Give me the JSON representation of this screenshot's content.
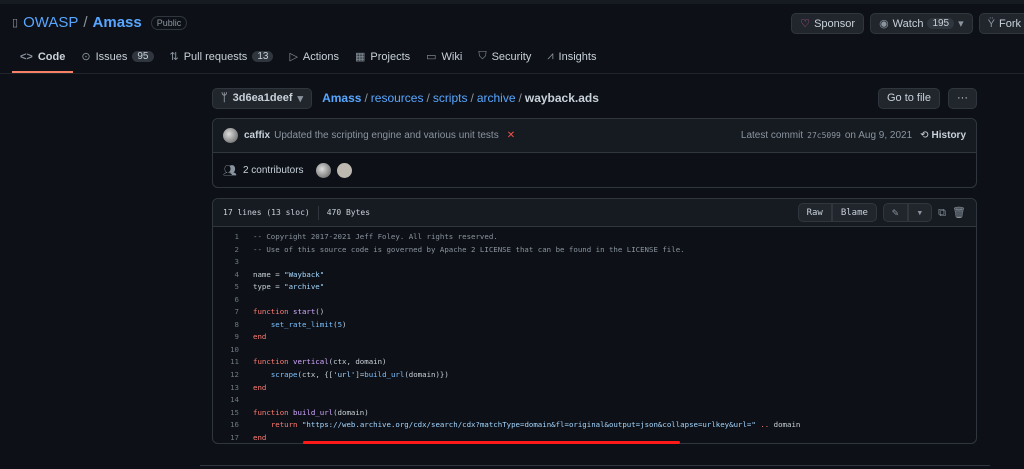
{
  "repo": {
    "owner": "OWASP",
    "separator": "/",
    "name": "Amass",
    "visibility": "Public"
  },
  "header_actions": {
    "sponsor": "Sponsor",
    "watch": "Watch",
    "watch_count": "195",
    "fork": "Fork"
  },
  "tabs": [
    {
      "label": "Code",
      "icon": "code-icon"
    },
    {
      "label": "Issues",
      "count": "95",
      "icon": "issue-icon"
    },
    {
      "label": "Pull requests",
      "count": "13",
      "icon": "pull-request-icon"
    },
    {
      "label": "Actions",
      "icon": "play-icon"
    },
    {
      "label": "Projects",
      "icon": "table-icon"
    },
    {
      "label": "Wiki",
      "icon": "book-icon"
    },
    {
      "label": "Security",
      "icon": "shield-icon"
    },
    {
      "label": "Insights",
      "icon": "graph-icon"
    }
  ],
  "branch": "3d6ea1deef",
  "breadcrumb": [
    "Amass",
    "resources",
    "scripts",
    "archive"
  ],
  "file_name": "wayback.ads",
  "goto_file": "Go to file",
  "more": "···",
  "commit": {
    "author": "caffix",
    "message": "Updated the scripting engine and various unit tests",
    "status": "✕",
    "latest_label": "Latest commit",
    "sha": "27c5099",
    "date_text": "on Aug 9, 2021",
    "history": "History"
  },
  "contributors": "2 contributors",
  "file_info": {
    "lines": "17 lines (13 sloc)",
    "size": "470 Bytes",
    "raw": "Raw",
    "blame": "Blame"
  },
  "code": [
    [
      [
        "c",
        "-- Copyright 2017-2021 Jeff Foley. All rights reserved."
      ]
    ],
    [
      [
        "c",
        "-- Use of this source code is governed by Apache 2 LICENSE that can be found in the LICENSE file."
      ]
    ],
    [],
    [
      [
        "p",
        "name = "
      ],
      [
        "st",
        "\"Wayback\""
      ]
    ],
    [
      [
        "p",
        "type = "
      ],
      [
        "st",
        "\"archive\""
      ]
    ],
    [],
    [
      [
        "k",
        "function "
      ],
      [
        "f",
        "start"
      ],
      [
        "p",
        "()"
      ]
    ],
    [
      [
        "p",
        "    "
      ],
      [
        "b",
        "set_rate_limit"
      ],
      [
        "p",
        "("
      ],
      [
        "b",
        "5"
      ],
      [
        "p",
        ")"
      ]
    ],
    [
      [
        "k",
        "end"
      ]
    ],
    [],
    [
      [
        "k",
        "function "
      ],
      [
        "f",
        "vertical"
      ],
      [
        "p",
        "(ctx, domain)"
      ]
    ],
    [
      [
        "p",
        "    "
      ],
      [
        "b",
        "scrape"
      ],
      [
        "p",
        "(ctx, {["
      ],
      [
        "st",
        "'url'"
      ],
      [
        "p",
        "]="
      ],
      [
        "b",
        "build_url"
      ],
      [
        "p",
        "(domain)})"
      ]
    ],
    [
      [
        "k",
        "end"
      ]
    ],
    [],
    [
      [
        "k",
        "function "
      ],
      [
        "f",
        "build_url"
      ],
      [
        "p",
        "(domain)"
      ]
    ],
    [
      [
        "p",
        "    "
      ],
      [
        "k",
        "return "
      ],
      [
        "st",
        "\"https://web.archive.org/cdx/search/cdx?matchType=domain&fl=original&output=json&collapse=urlkey&url=\""
      ],
      [
        "k",
        " .. "
      ],
      [
        "p",
        "domain"
      ]
    ],
    [
      [
        "k",
        "end"
      ]
    ]
  ]
}
